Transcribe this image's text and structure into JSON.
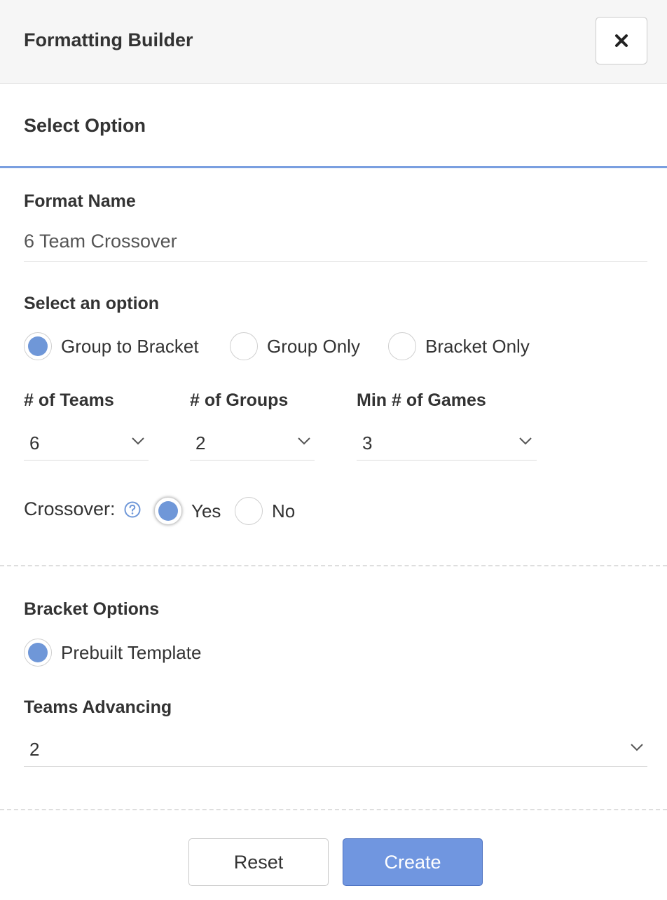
{
  "header": {
    "title": "Formatting Builder",
    "close_icon": "close-icon"
  },
  "section": {
    "title": "Select Option"
  },
  "format_name": {
    "label": "Format Name",
    "value": "6 Team Crossover"
  },
  "option": {
    "label": "Select an option",
    "choices": [
      {
        "label": "Group to Bracket",
        "selected": true
      },
      {
        "label": "Group Only",
        "selected": false
      },
      {
        "label": "Bracket Only",
        "selected": false
      }
    ]
  },
  "teams": {
    "label": "# of Teams",
    "value": "6"
  },
  "groups": {
    "label": "# of Groups",
    "value": "2"
  },
  "min_games": {
    "label": "Min # of Games",
    "value": "3"
  },
  "crossover": {
    "label": "Crossover:",
    "help_icon": "help-icon",
    "choices": [
      {
        "label": "Yes",
        "selected": true
      },
      {
        "label": "No",
        "selected": false
      }
    ]
  },
  "bracket": {
    "label": "Bracket Options",
    "choices": [
      {
        "label": "Prebuilt Template",
        "selected": true
      }
    ]
  },
  "advancing": {
    "label": "Teams Advancing",
    "value": "2"
  },
  "footer": {
    "reset_label": "Reset",
    "create_label": "Create"
  },
  "colors": {
    "accent": "#6f97d8",
    "create_button": "#7096e0",
    "section_underline": "#7a9fe0"
  }
}
